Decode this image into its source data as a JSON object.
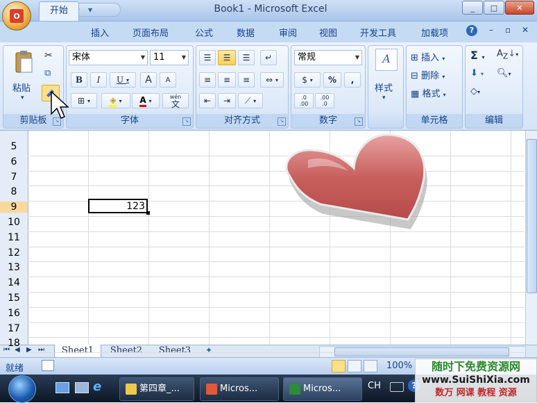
{
  "window": {
    "title": "Book1 - Microsoft Excel"
  },
  "ribbon_tabs": [
    "开始",
    "插入",
    "页面布局",
    "公式",
    "数据",
    "审阅",
    "视图",
    "开发工具",
    "加载项"
  ],
  "clipboard": {
    "paste_label": "粘贴",
    "group_label": "剪贴板"
  },
  "font": {
    "name": "宋体",
    "size": "11",
    "bold": "B",
    "italic": "I",
    "underline": "U",
    "grow": "A",
    "shrink": "A",
    "font_color": "A",
    "phonetic_top": "wén",
    "phonetic": "文",
    "group_label": "字体"
  },
  "alignment": {
    "group_label": "对齐方式"
  },
  "number": {
    "format": "常规",
    "percent": "%",
    "comma": ",",
    "inc_dec_1": ".0",
    "inc_dec_2": ".00",
    "inc_dec_3": ".00",
    "inc_dec_4": ".0",
    "group_label": "数字"
  },
  "styles": {
    "label": "样式"
  },
  "cells": {
    "insert": "插入",
    "delete": "删除",
    "format": "格式",
    "group_label": "单元格"
  },
  "editing": {
    "sum": "Σ",
    "sort": "A",
    "sort_sub": "Z",
    "group_label": "编辑"
  },
  "grid": {
    "rows": [
      "5",
      "6",
      "7",
      "8",
      "9",
      "10",
      "11",
      "12",
      "13",
      "14",
      "15",
      "16",
      "17",
      "18"
    ],
    "selected_row": "9",
    "active_cell_value": "123"
  },
  "sheets": [
    "Sheet1",
    "Sheet2",
    "Sheet3"
  ],
  "status": {
    "mode": "就绪",
    "zoom": "100%"
  },
  "taskbar": {
    "items": [
      "第四章_...",
      "Micros...",
      "Micros..."
    ],
    "lang": "CH"
  },
  "watermark": {
    "line1": "随时下免费资源网",
    "line2": "www.SuiShiXia.com",
    "line3": "数万 网课 教程 资源"
  },
  "colors": {
    "accent": "#15428b",
    "ribbon_bg": "#d5e4f7",
    "heart": "#c9605e"
  }
}
